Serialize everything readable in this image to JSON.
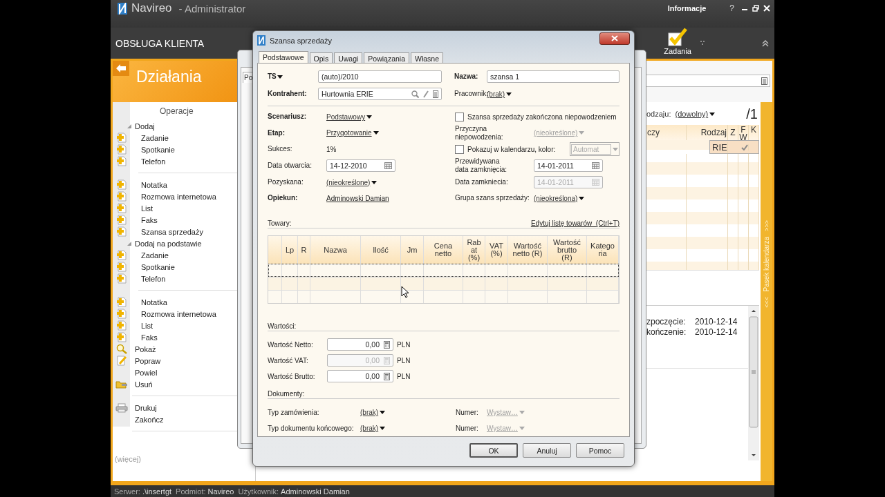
{
  "app": {
    "brand": "Navireo",
    "role": "- Administrator",
    "info": "Informacje",
    "help": "?"
  },
  "toolbar": {
    "section": "OBSŁUGA KLIENTA",
    "tasks": "Zadania"
  },
  "sidebar": {
    "title": "Działania",
    "heading": "Operacje",
    "more": "(więcej)",
    "entries": [
      {
        "kind": "group",
        "label": "Dodaj",
        "expanded": true,
        "children": [
          {
            "kind": "add",
            "label": "Zadanie"
          },
          {
            "kind": "add",
            "label": "Spotkanie"
          },
          {
            "kind": "add",
            "label": "Telefon"
          },
          {
            "kind": "separator"
          },
          {
            "kind": "add",
            "label": "Notatka"
          },
          {
            "kind": "add",
            "label": "Rozmowa internetowa"
          },
          {
            "kind": "add",
            "label": "List"
          },
          {
            "kind": "add",
            "label": "Faks"
          },
          {
            "kind": "add",
            "label": "Szansa sprzedaży"
          }
        ]
      },
      {
        "kind": "group",
        "label": "Dodaj na podstawie",
        "expanded": true,
        "children": [
          {
            "kind": "add",
            "label": "Zadanie"
          },
          {
            "kind": "add",
            "label": "Spotkanie"
          },
          {
            "kind": "add",
            "label": "Telefon"
          },
          {
            "kind": "separator"
          },
          {
            "kind": "add",
            "label": "Notatka"
          },
          {
            "kind": "add",
            "label": "Rozmowa internetowa"
          },
          {
            "kind": "add",
            "label": "List"
          },
          {
            "kind": "add",
            "label": "Faks"
          }
        ]
      },
      {
        "kind": "show",
        "label": "Pokaż"
      },
      {
        "kind": "edit",
        "label": "Popraw"
      },
      {
        "kind": "plain",
        "label": "Powiel"
      },
      {
        "kind": "delete",
        "label": "Usuń"
      },
      {
        "kind": "separator"
      },
      {
        "kind": "print",
        "label": "Drukuj"
      },
      {
        "kind": "plain",
        "label": "Zakończ"
      },
      {
        "kind": "separator"
      }
    ]
  },
  "list": {
    "filter_label": "odzaju:",
    "filter_value": "(dowolny)",
    "page": "/1",
    "columns": [
      "czy",
      "Rodzaj",
      "Z",
      "F W",
      "K"
    ],
    "rows": [
      {
        "column_1": "RIE",
        "selected": true,
        "checked": true
      }
    ],
    "details": [
      {
        "label": "zpoczęcie:",
        "value": "2010-12-14"
      },
      {
        "label": "kończenie:",
        "value": "2010-12-14"
      }
    ]
  },
  "calendar_strip": {
    "label": "Pasek kalendarza",
    "expand": ">>>",
    "collapse": "<<<"
  },
  "behind_window": {
    "tab": "Po"
  },
  "dialog": {
    "title": "Szansa sprzedaży",
    "tabs": [
      {
        "label": "Podstawowe",
        "selected": true
      },
      {
        "label": "Opis",
        "selected": false
      },
      {
        "label": "Uwagi",
        "selected": false
      },
      {
        "label": "Powiązania",
        "selected": false
      },
      {
        "label": "Własne",
        "selected": false
      }
    ],
    "header_rows": [
      {
        "left": {
          "label": "TS",
          "label_menu": true,
          "bold": true,
          "kind": "input",
          "value": "(auto)/2010"
        },
        "right": {
          "label": "Nazwa:",
          "bold": true,
          "kind": "input",
          "value": "szansa 1"
        }
      },
      {
        "left": {
          "label": "Kontrahent:",
          "bold": true,
          "kind": "lookup",
          "value": "Hurtownia ERIE"
        },
        "right": {
          "label": "Pracownik:",
          "bold": false,
          "kind": "dropdown",
          "value": "(brak)",
          "disabled": false
        }
      }
    ],
    "main_rows": [
      {
        "left": {
          "label": "Scenariusz:",
          "bold": true,
          "kind": "dropdown",
          "value": "Podstawowy",
          "disabled": false
        },
        "right": {
          "kind": "checkbox",
          "label": "Szansa sprzedaży zakończona niepowodzeniem",
          "checked": false
        }
      },
      {
        "left": {
          "label": "Etap:",
          "bold": true,
          "kind": "dropdown",
          "value": "Przygotowanie",
          "disabled": false
        },
        "right": {
          "label": "Przyczyna niepowodzenia:",
          "bold": false,
          "kind": "dropdown",
          "value": "(nieokreślone)",
          "disabled": true
        }
      },
      {
        "left": {
          "label": "Sukces:",
          "bold": false,
          "kind": "static",
          "value": "1%"
        },
        "right": {
          "kind": "checkbox-select",
          "label": "Pokazuj w kalendarzu, kolor:",
          "checked": false,
          "value": "Automat",
          "disabled": true
        }
      },
      {
        "left": {
          "label": "Data otwarcia:",
          "bold": false,
          "kind": "date",
          "value": "14-12-2010",
          "disabled": false
        },
        "right": {
          "label": "Przewidywana\ndata zamknięcia:",
          "bold": false,
          "kind": "date",
          "value": "14-01-2011",
          "disabled": false
        }
      },
      {
        "left": {
          "label": "Pozyskana:",
          "bold": false,
          "kind": "dropdown",
          "value": "(nieokreślone)",
          "disabled": false
        },
        "right": {
          "label": "Data zamkniecia:",
          "bold": false,
          "kind": "date",
          "value": "14-01-2011",
          "disabled": true
        }
      },
      {
        "left": {
          "label": "Opiekun:",
          "bold": true,
          "kind": "link",
          "value": "Adminowski Damian"
        },
        "right": {
          "label": "Grupa szans sprzedaży:",
          "bold": false,
          "kind": "dropdown",
          "value": "(nieokreślona)",
          "disabled": false
        }
      }
    ],
    "goods": {
      "heading": "Towary:",
      "edit_link": "Edytuj listę towarów  (Ctrl+T)",
      "columns": [
        "Lp",
        "R",
        "Nazwa",
        "Ilość",
        "Jm",
        "Cena\nnetto",
        "Rab\nat\n(%)",
        "VAT\n(%)",
        "Wartość\nnetto (R)",
        "Wartość\nbrutto\n(R)",
        "Katego\nria"
      ],
      "rows": [
        {
          "selected": true
        },
        {
          "selected": false
        },
        {
          "selected": false
        }
      ]
    },
    "values": {
      "heading": "Wartości:",
      "rows": [
        {
          "label": "Wartość Netto:",
          "value": "0,00",
          "currency": "PLN",
          "disabled": false
        },
        {
          "label": "Wartość VAT:",
          "value": "0,00",
          "currency": "PLN",
          "disabled": true
        },
        {
          "label": "Wartość Brutto:",
          "value": "0,00",
          "currency": "PLN",
          "disabled": false
        }
      ]
    },
    "documents": {
      "heading": "Dokumenty:",
      "rows": [
        {
          "label": "Typ zamówienia:",
          "value": "(brak)",
          "disabled": false,
          "number_label": "Numer:",
          "number_value": "Wystaw…",
          "number_disabled": true
        },
        {
          "label": "Typ dokumentu końcowego:",
          "value": "(brak)",
          "disabled": false,
          "number_label": "Numer:",
          "number_value": "Wystaw…",
          "number_disabled": true
        }
      ]
    },
    "buttons": [
      {
        "label": "OK",
        "default": true
      },
      {
        "label": "Anuluj",
        "default": false
      },
      {
        "label": "Pomoc",
        "default": false
      }
    ]
  },
  "status_bar": [
    {
      "label": "Serwer:",
      "value": ".\\insertgt"
    },
    {
      "label": "Podmiot:",
      "value": "Navireo"
    },
    {
      "label": "Użytkownik:",
      "value": "Adminowski Damian"
    }
  ]
}
